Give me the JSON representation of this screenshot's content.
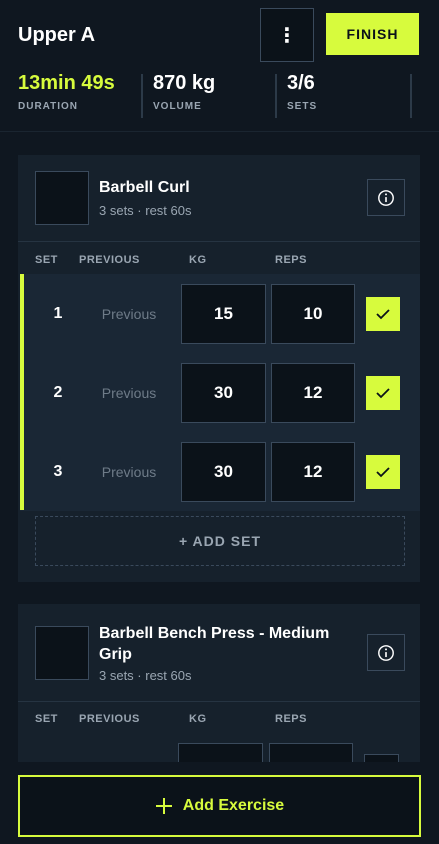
{
  "header": {
    "title": "Upper A",
    "menu_glyph": "⋮",
    "finish_label": "FINISH"
  },
  "stats": [
    {
      "value": "13min 49s",
      "label": "DURATION"
    },
    {
      "value": "870 kg",
      "label": "VOLUME"
    },
    {
      "value": "3/6",
      "label": "SETS"
    }
  ],
  "columns": {
    "set": "SET",
    "previous": "PREVIOUS",
    "kg": "KG",
    "reps": "REPS"
  },
  "exercises": [
    {
      "name": "Barbell Curl",
      "meta": "3 sets · rest 60s",
      "sets": [
        {
          "num": "1",
          "previous": "Previous",
          "kg": "15",
          "reps": "10",
          "done": true
        },
        {
          "num": "2",
          "previous": "Previous",
          "kg": "30",
          "reps": "12",
          "done": true
        },
        {
          "num": "3",
          "previous": "Previous",
          "kg": "30",
          "reps": "12",
          "done": true
        }
      ],
      "add_set_label": "+ ADD SET"
    },
    {
      "name_line1": "Barbell Bench Press - Medium",
      "name_line2": "Grip",
      "meta": "3 sets · rest 60s"
    }
  ],
  "add_exercise_label": "Add Exercise",
  "icons": {
    "menu": "more-vertical-icon",
    "info": "info-icon",
    "check": "check-icon",
    "plus": "plus-icon"
  },
  "colors": {
    "accent": "#d7fb3d",
    "background": "#0f1720",
    "card": "#16212c",
    "input": "#0b1219",
    "muted_text": "#9aa6b2"
  }
}
